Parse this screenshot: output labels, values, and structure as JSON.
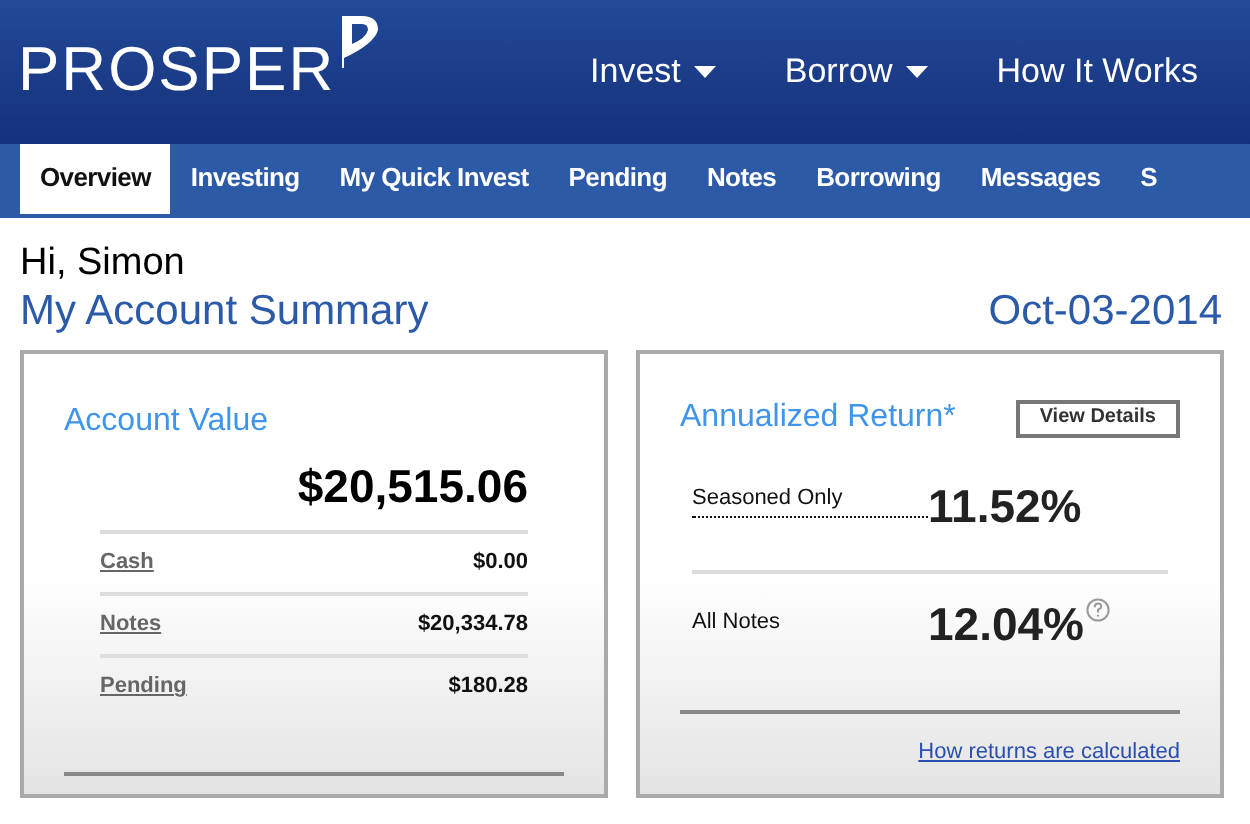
{
  "header": {
    "logo": "PROSPER",
    "nav": [
      {
        "label": "Invest",
        "dropdown": true
      },
      {
        "label": "Borrow",
        "dropdown": true
      },
      {
        "label": "How It Works",
        "dropdown": false
      }
    ]
  },
  "tabs": [
    {
      "label": "Overview",
      "selected": true
    },
    {
      "label": "Investing",
      "selected": false
    },
    {
      "label": "My Quick Invest",
      "selected": false
    },
    {
      "label": "Pending",
      "selected": false
    },
    {
      "label": "Notes",
      "selected": false
    },
    {
      "label": "Borrowing",
      "selected": false
    },
    {
      "label": "Messages",
      "selected": false
    },
    {
      "label": "S",
      "selected": false
    }
  ],
  "greeting": "Hi, Simon",
  "title": "My Account Summary",
  "date": "Oct-03-2014",
  "account_value": {
    "title": "Account Value",
    "total": "$20,515.06",
    "rows": [
      {
        "label": "Cash",
        "value": "$0.00"
      },
      {
        "label": "Notes",
        "value": "$20,334.78"
      },
      {
        "label": "Pending",
        "value": "$180.28"
      }
    ]
  },
  "annualized_return": {
    "title": "Annualized Return*",
    "button": "View Details",
    "rows": [
      {
        "label": "Seasoned Only",
        "value": "11.52%",
        "help": false
      },
      {
        "label": "All Notes",
        "value": "12.04%",
        "help": true
      }
    ],
    "link": "How returns are calculated"
  }
}
